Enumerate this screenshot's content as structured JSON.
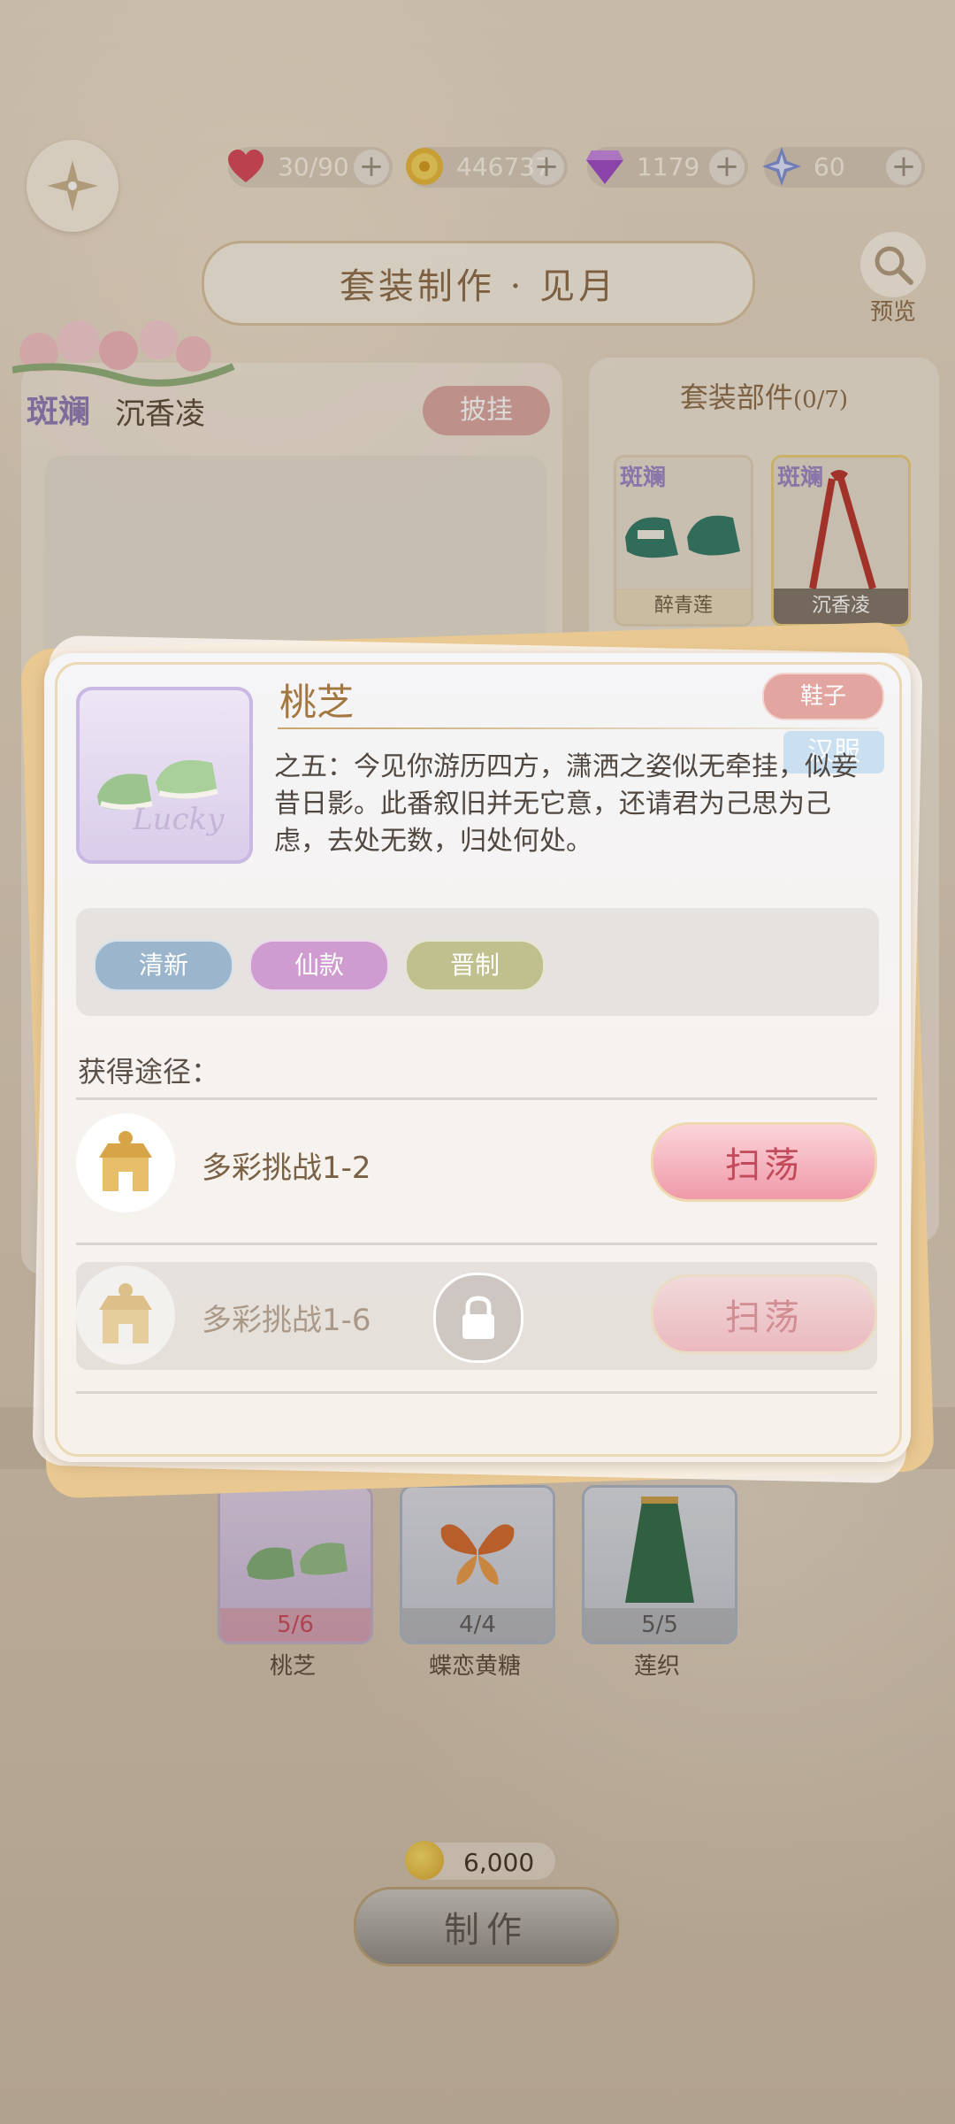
{
  "resources": [
    {
      "icon": "heart-icon",
      "value": "30/90"
    },
    {
      "icon": "coin-icon",
      "value": "446737"
    },
    {
      "icon": "diamond-icon",
      "value": "1179"
    },
    {
      "icon": "star-icon",
      "value": "60"
    }
  ],
  "header": {
    "title": "套装制作 · 见月",
    "preview_label": "预览"
  },
  "left_panel": {
    "tag": "斑斓",
    "name": "沉香凌",
    "pigua_button": "披挂"
  },
  "parts": {
    "title": "套装部件",
    "count": "(0/7)",
    "items": [
      {
        "tag": "斑斓",
        "label": "醉青莲"
      },
      {
        "tag": "斑斓",
        "label": "沉香凌"
      }
    ]
  },
  "popup": {
    "item_title": "桃芝",
    "type_tag": "鞋子",
    "faded_tag": "汉服",
    "frame_watermark": "Lucky",
    "description": "之五：今见你游历四方，潇洒之姿似无牵挂，似妾昔日影。此番叙旧并无它意，还请君为己思为己虑，去处无数，归处何处。",
    "tags": [
      {
        "label": "清新",
        "color": "#9ab5cc"
      },
      {
        "label": "仙款",
        "color": "#cf9ccf"
      },
      {
        "label": "晋制",
        "color": "#bfc08d"
      }
    ],
    "source_label": "获得途径：",
    "routes": [
      {
        "name": "多彩挑战1-2",
        "button": "扫荡",
        "locked": false
      },
      {
        "name": "多彩挑战1-6",
        "button": "扫荡",
        "locked": true
      }
    ]
  },
  "bottom_items": [
    {
      "name": "桃芝",
      "count": "5/6"
    },
    {
      "name": "蝶恋黄糖",
      "count": "4/4"
    },
    {
      "name": "莲织",
      "count": "5/5"
    }
  ],
  "craft": {
    "cost": "6,000",
    "button": "制作"
  }
}
